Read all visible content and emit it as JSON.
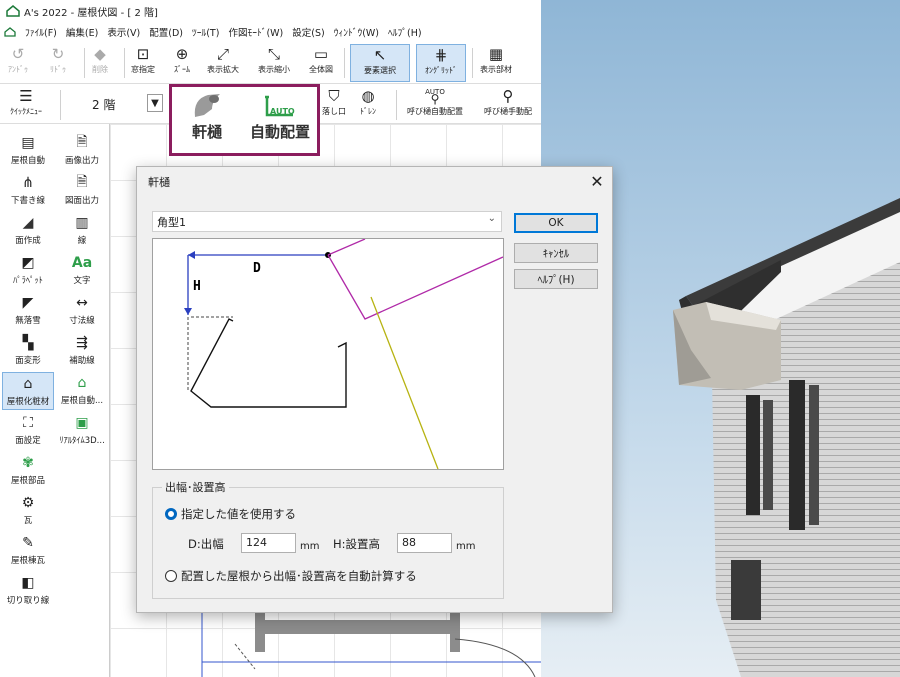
{
  "window": {
    "title": "A's 2022 - 屋根伏図 - [ 2 階]"
  },
  "menu": [
    "ﾌｧｲﾙ(F)",
    "編集(E)",
    "表示(V)",
    "配置(D)",
    "ﾂｰﾙ(T)",
    "作図ﾓｰﾄﾞ(W)",
    "設定(S)",
    "ｳｨﾝﾄﾞｳ(W)",
    "ﾍﾙﾌﾟ(H)"
  ],
  "toolbar": {
    "undo": "ｱﾝﾄﾞｩ",
    "redo": "ﾘﾄﾞｩ",
    "delete": "削除",
    "zoom_specify": "窓指定",
    "zoom": "ｽﾞｰﾑ",
    "zoom_in": "表示拡大",
    "zoom_out": "表示縮小",
    "fit_all": "全体図",
    "select": "要素選択",
    "ongrid": "ｵﾝｸﾞﾘｯﾄﾞ",
    "show_parts": "表示部材",
    "quick_menu": "ｸｲｯｸﾒﾆｭｰ",
    "floor": "2 階",
    "drop_outlet": "落し口",
    "drain": "ﾄﾞﾚﾝ",
    "downpipe_auto": "呼び樋自動配置",
    "downpipe_manual": "呼び樋手動配",
    "auto_tag": "AUTO"
  },
  "callout": {
    "eave_gutter": "軒樋",
    "auto_place": "自動配置",
    "auto_tag": "AUTO"
  },
  "sidebar": [
    "屋根自動",
    "画像出力",
    "下書き線",
    "図面出力",
    "面作成",
    "線",
    "ﾊﾟﾗﾍﾟｯﾄ",
    "文字",
    "無落雪",
    "寸法線",
    "面変形",
    "補助線",
    "屋根化粧材",
    "屋根自動...",
    "面設定",
    "ﾘｱﾙﾀｲﾑ3D...",
    "屋根部品",
    "瓦",
    "屋根棟瓦",
    "切り取り線"
  ],
  "dialog": {
    "title": "軒樋",
    "type_value": "角型1",
    "ok": "OK",
    "cancel": "ｷｬﾝｾﾙ",
    "help": "ﾍﾙﾌﾟ(H)",
    "diagram": {
      "d_label": "D",
      "h_label": "H"
    },
    "group_title": "出幅･設置高",
    "radio_specified": "指定した値を使用する",
    "d_label": "D:出幅",
    "d_value": "124",
    "h_label": "H:設置高",
    "h_value": "88",
    "unit": "mm",
    "radio_auto": "配置した屋根から出幅･設置高を自動計算する"
  },
  "colors": {
    "accent": "#0078d7",
    "callout_border": "#8b1d5e",
    "auto_green": "#2e9e4a",
    "roof_magenta": "#b02aa8"
  }
}
